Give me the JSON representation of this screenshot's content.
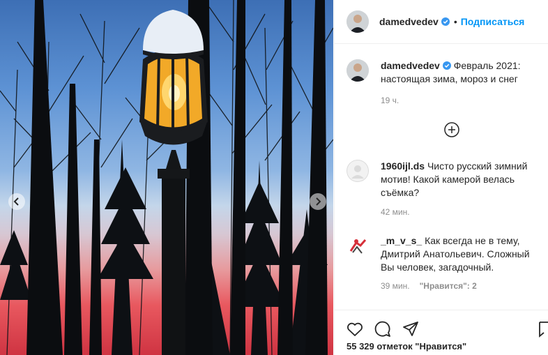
{
  "post": {
    "username": "damedvedev",
    "follow_label": "Подписаться",
    "separator": "•",
    "caption_username": "damedvedev",
    "caption_text": "Февраль 2021: настоящая зима, мороз и снег",
    "caption_time": "19 ч.",
    "likes_text": "55 329 отметок \"Нравится\""
  },
  "comments": [
    {
      "username": "1960ijl.ds",
      "text": "Чисто русский зимний мотив! Какой камерой велась съёмка?",
      "time": "42 мин.",
      "likes": ""
    },
    {
      "username": "_m_v_s_",
      "text": "Как всегда не в тему, Дмитрий Анатольевич. Сложный Вы человек, загадочный.",
      "time": "39 мин.",
      "likes": "\"Нравится\": 2"
    }
  ],
  "icons": {
    "verified": "verified-badge-icon",
    "prev": "chevron-left-icon",
    "next": "chevron-right-icon",
    "load_more": "plus-circle-icon",
    "like": "heart-icon",
    "comment": "comment-bubble-icon",
    "share": "paper-plane-icon",
    "save": "bookmark-icon"
  },
  "colors": {
    "link": "#0095f6",
    "verified": "#3897f0",
    "text": "#262626",
    "muted": "#8e8e8e"
  }
}
